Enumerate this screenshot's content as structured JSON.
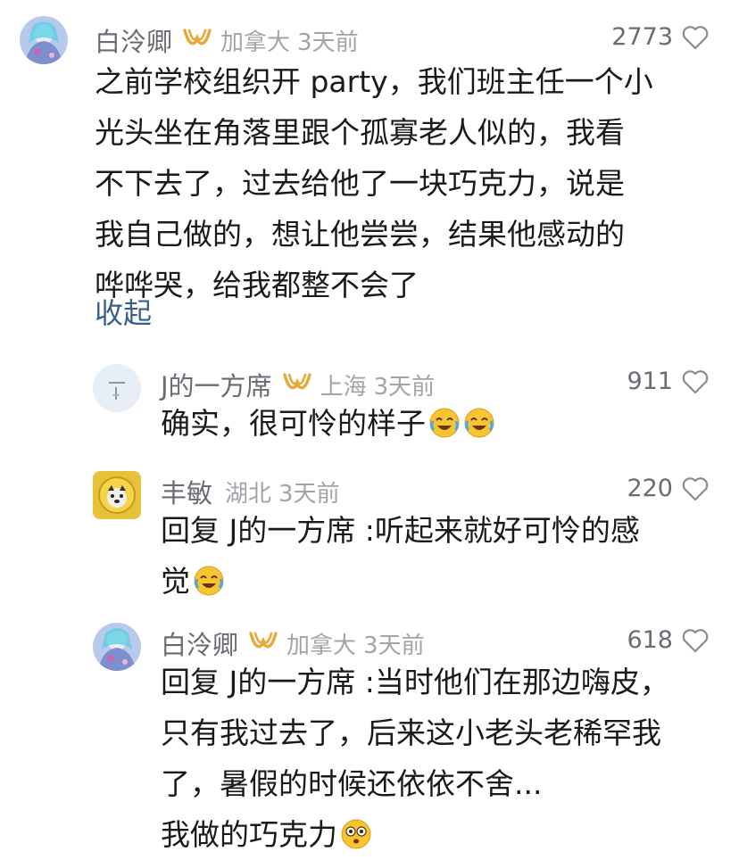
{
  "comments": [
    {
      "user": "白泠卿",
      "location": "加拿大",
      "time": "3天前",
      "likes": "2773",
      "lines": [
        "之前学校组织开 party，我们班主任一个小",
        "光头坐在角落里跟个孤寡老人似的，我看",
        "不下去了，过去给他了一块巧克力，说是",
        "我自己做的，想让他尝尝，结果他感动的",
        "哗哗哭，给我都整不会了"
      ],
      "collapse": "收起"
    },
    {
      "user": "J的一方席",
      "location": "上海",
      "time": "3天前",
      "likes": "911",
      "text": "确实，很可怜的样子"
    },
    {
      "user": "丰敏",
      "location": "湖北",
      "time": "3天前",
      "likes": "220",
      "reply_prefix": "回复 J的一方席 :",
      "line1": "听起来就好可怜的感",
      "line2": "觉"
    },
    {
      "user": "白泠卿",
      "location": "加拿大",
      "time": "3天前",
      "likes": "618",
      "reply_prefix": "回复 J的一方席 :",
      "line1": "当时他们在那边嗨皮，",
      "line2": "只有我过去了，后来这小老头老稀罕我",
      "line3": "了，暑假的时候还依依不舍...",
      "line4": "我做的巧克力"
    }
  ],
  "icons": {
    "like": "heart-outline-icon",
    "badge": "vip-badge-icon",
    "emoji_cry": "crying-laughing-emoji-icon",
    "emoji_dizzy": "dizzy-face-emoji-icon"
  },
  "colors": {
    "name": "#6b6b73",
    "location": "#a3a3aa",
    "collapse": "#3a5e8c",
    "badge": "#e6a93a"
  }
}
